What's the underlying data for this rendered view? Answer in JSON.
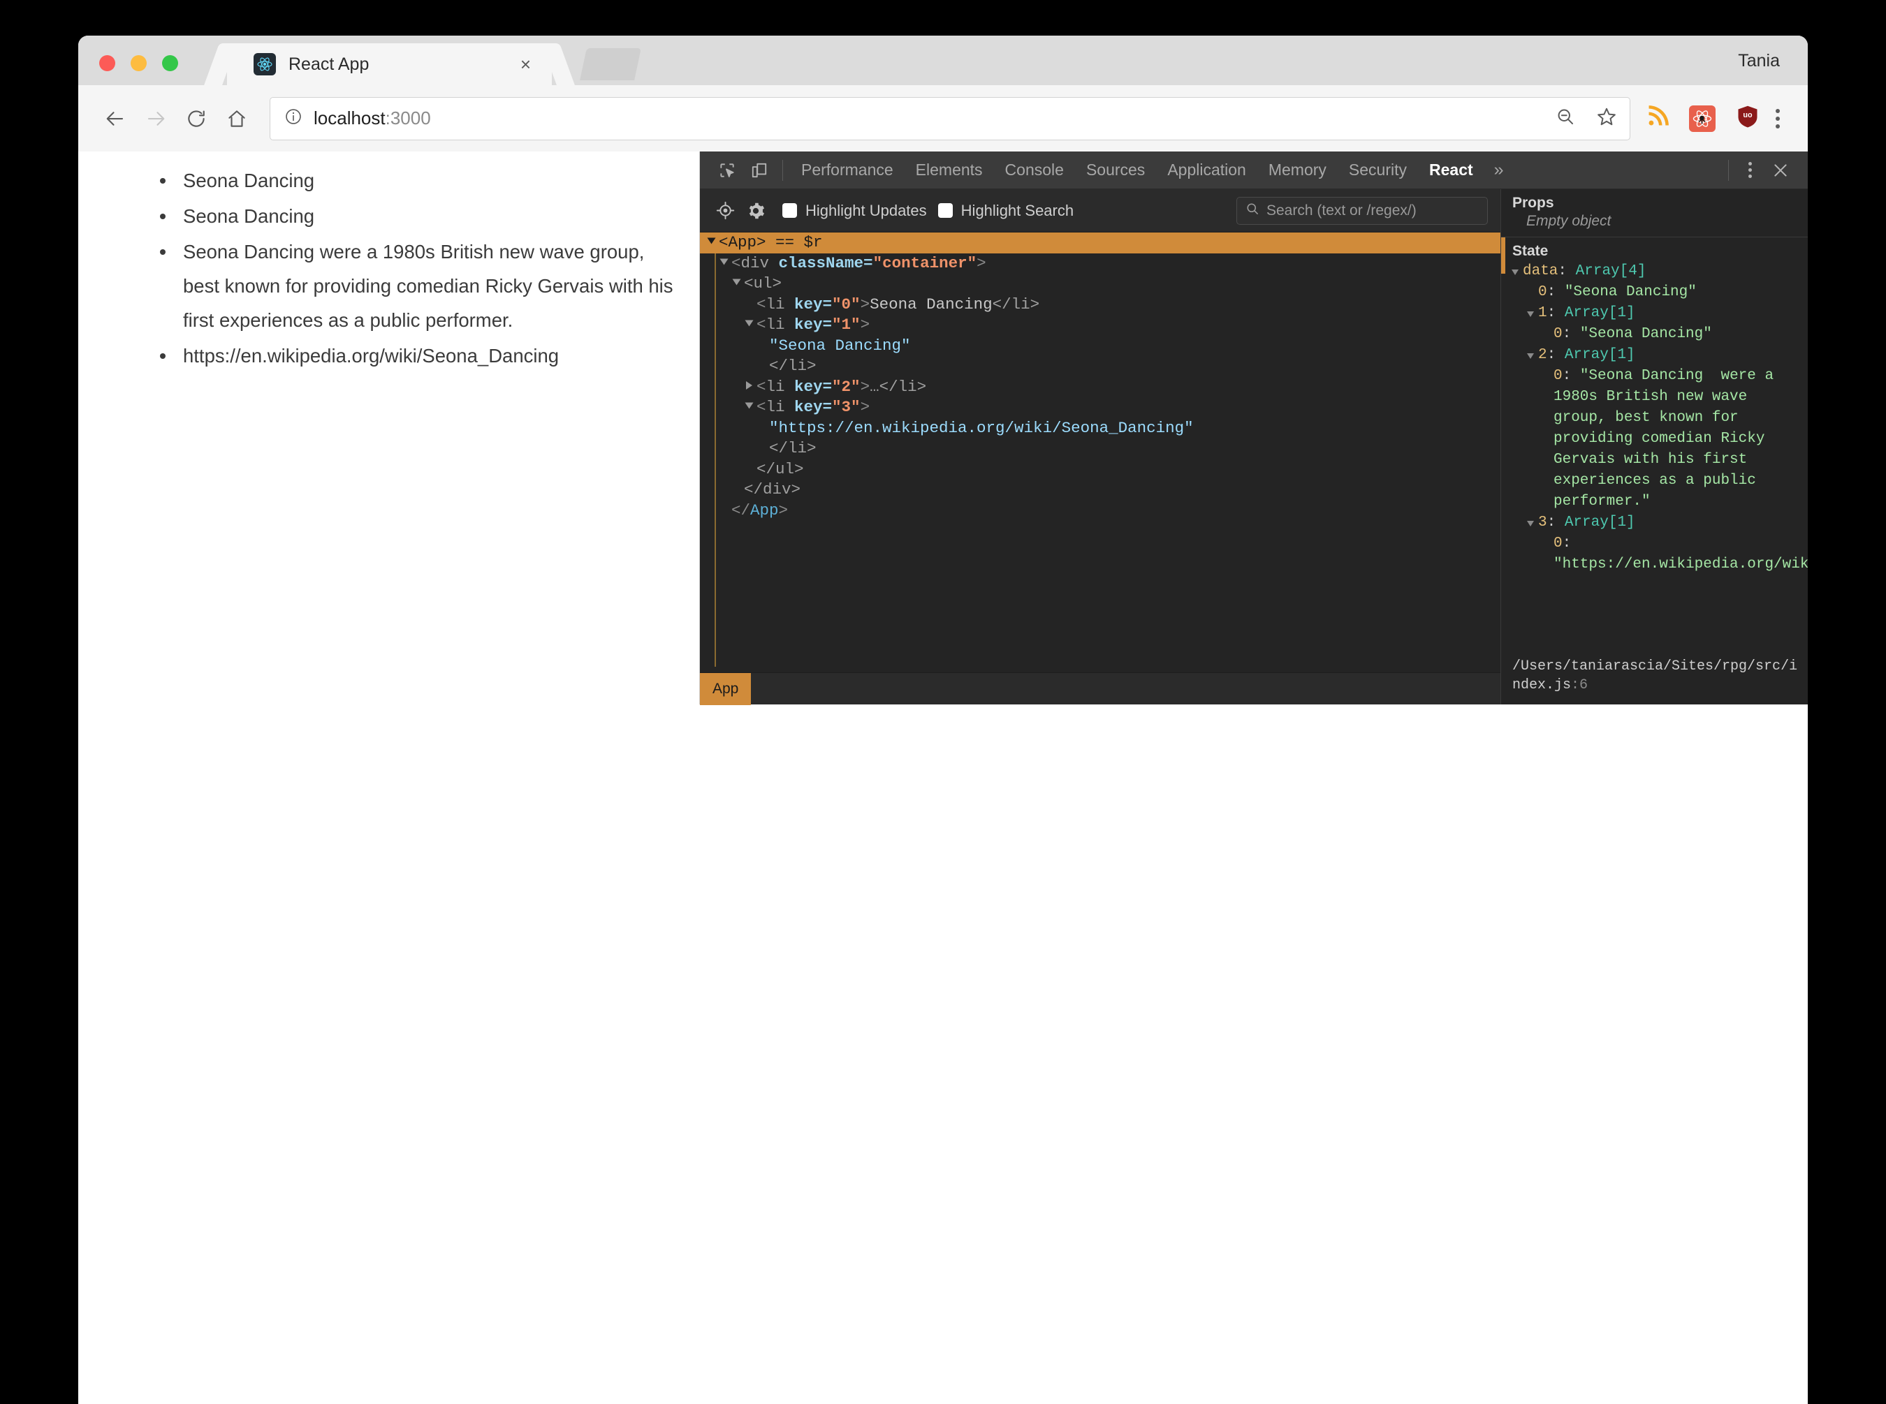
{
  "browser": {
    "tab": {
      "title": "React App",
      "favicon": "react-logo-icon",
      "close": "×"
    },
    "profile_name": "Tania",
    "url": {
      "scheme_icon": "info-circle-icon",
      "host": "localhost",
      "port": ":3000"
    },
    "nav": {
      "back": "back-arrow-icon",
      "forward": "forward-arrow-icon",
      "reload": "reload-icon",
      "home": "home-icon",
      "zoom_out": "zoom-out-icon",
      "bookmark": "star-icon",
      "menu": "kebab-menu-icon"
    },
    "extensions": [
      {
        "name": "rss-feed-icon",
        "color": "#f5a623"
      },
      {
        "name": "react-devtools-extension-icon",
        "color": "#e8604c"
      },
      {
        "name": "ublock-origin-icon",
        "color": "#8b1a1a",
        "label": "uo"
      }
    ]
  },
  "page": {
    "items": [
      "Seona Dancing",
      "Seona Dancing",
      "Seona Dancing were a 1980s British new wave group, best known for providing comedian Ricky Gervais with his first experiences as a public performer.",
      "https://en.wikipedia.org/wiki/Seona_Dancing"
    ]
  },
  "devtools": {
    "inspect_icon": "inspect-element-icon",
    "device_icon": "device-toolbar-icon",
    "tabs": [
      {
        "label": "Performance",
        "active": false
      },
      {
        "label": "Elements",
        "active": false
      },
      {
        "label": "Console",
        "active": false
      },
      {
        "label": "Sources",
        "active": false
      },
      {
        "label": "Application",
        "active": false
      },
      {
        "label": "Memory",
        "active": false
      },
      {
        "label": "Security",
        "active": false
      },
      {
        "label": "React",
        "active": true
      }
    ],
    "more_tabs": "»",
    "close": "✕",
    "react_toolbar": {
      "select_icon": "target-select-icon",
      "settings_icon": "gear-icon",
      "highlight_updates": {
        "label": "Highlight Updates",
        "checked": false
      },
      "highlight_search": {
        "label": "Highlight Search",
        "checked": false
      },
      "search_placeholder": "Search (text or /regex/)",
      "search_value": ""
    },
    "tree": [
      {
        "indent": 0,
        "caret": "open",
        "selected": true,
        "tokens": [
          {
            "t": "tag",
            "v": "<App>"
          },
          {
            "t": "plain",
            "v": " == $r"
          }
        ]
      },
      {
        "indent": 1,
        "caret": "open",
        "selected": false,
        "tokens": [
          {
            "t": "bracket",
            "v": "<"
          },
          {
            "t": "elem",
            "v": "div "
          },
          {
            "t": "attr",
            "v": "className="
          },
          {
            "t": "val",
            "v": "\"container\""
          },
          {
            "t": "bracket",
            "v": ">"
          }
        ]
      },
      {
        "indent": 2,
        "caret": "open",
        "selected": false,
        "tokens": [
          {
            "t": "elem",
            "v": "<ul>"
          }
        ]
      },
      {
        "indent": 3,
        "caret": "none",
        "selected": false,
        "tokens": [
          {
            "t": "bracket",
            "v": "<"
          },
          {
            "t": "elem",
            "v": "li "
          },
          {
            "t": "attr",
            "v": "key="
          },
          {
            "t": "val",
            "v": "\"0\""
          },
          {
            "t": "bracket",
            "v": ">"
          },
          {
            "t": "plain",
            "v": "Seona Dancing"
          },
          {
            "t": "elem",
            "v": "</li>"
          }
        ]
      },
      {
        "indent": 3,
        "caret": "open",
        "selected": false,
        "tokens": [
          {
            "t": "bracket",
            "v": "<"
          },
          {
            "t": "elem",
            "v": "li "
          },
          {
            "t": "attr",
            "v": "key="
          },
          {
            "t": "val",
            "v": "\"1\""
          },
          {
            "t": "bracket",
            "v": ">"
          }
        ]
      },
      {
        "indent": 4,
        "caret": "none",
        "selected": false,
        "tokens": [
          {
            "t": "str",
            "v": "\"Seona Dancing\""
          }
        ]
      },
      {
        "indent": 4,
        "caret": "none",
        "selected": false,
        "tokens": [
          {
            "t": "elem",
            "v": "</li>"
          }
        ]
      },
      {
        "indent": 3,
        "caret": "closed",
        "selected": false,
        "tokens": [
          {
            "t": "bracket",
            "v": "<"
          },
          {
            "t": "elem",
            "v": "li "
          },
          {
            "t": "attr",
            "v": "key="
          },
          {
            "t": "val",
            "v": "\"2\""
          },
          {
            "t": "bracket",
            "v": ">"
          },
          {
            "t": "elem",
            "v": "…</li>"
          }
        ]
      },
      {
        "indent": 3,
        "caret": "open",
        "selected": false,
        "tokens": [
          {
            "t": "bracket",
            "v": "<"
          },
          {
            "t": "elem",
            "v": "li "
          },
          {
            "t": "attr",
            "v": "key="
          },
          {
            "t": "val",
            "v": "\"3\""
          },
          {
            "t": "bracket",
            "v": ">"
          }
        ]
      },
      {
        "indent": 4,
        "caret": "none",
        "selected": false,
        "tokens": [
          {
            "t": "str",
            "v": "\"https://en.wikipedia.org/wiki/Seona_Dancing\""
          }
        ]
      },
      {
        "indent": 4,
        "caret": "none",
        "selected": false,
        "tokens": [
          {
            "t": "elem",
            "v": "</li>"
          }
        ]
      },
      {
        "indent": 3,
        "caret": "none",
        "selected": false,
        "tokens": [
          {
            "t": "elem",
            "v": "</ul>"
          }
        ]
      },
      {
        "indent": 2,
        "caret": "none",
        "selected": false,
        "tokens": [
          {
            "t": "elem",
            "v": "</div>"
          }
        ]
      },
      {
        "indent": 1,
        "caret": "none",
        "selected": false,
        "tokens": [
          {
            "t": "bracket",
            "v": "</"
          },
          {
            "t": "tag",
            "v": "App"
          },
          {
            "t": "bracket",
            "v": ">"
          }
        ]
      }
    ],
    "breadcrumb": "App",
    "sidebar": {
      "props_title": "Props",
      "props_empty": "Empty object",
      "state_title": "State",
      "state_rows": [
        {
          "indent": 0,
          "caret": "open",
          "key": "data",
          "sep": ": ",
          "type": "Array[4]"
        },
        {
          "indent": 1,
          "caret": "none",
          "key": "0",
          "sep": ": ",
          "str": "\"Seona Dancing\""
        },
        {
          "indent": 1,
          "caret": "open",
          "key": "1",
          "sep": ": ",
          "type": "Array[1]"
        },
        {
          "indent": 2,
          "caret": "none",
          "key": "0",
          "sep": ": ",
          "str": "\"Seona Dancing\""
        },
        {
          "indent": 1,
          "caret": "open",
          "key": "2",
          "sep": ": ",
          "type": "Array[1]"
        },
        {
          "indent": 2,
          "caret": "none",
          "key": "0",
          "sep": ": ",
          "str": "\"Seona Dancing  were a 1980s British new wave group, best known for providing comedian Ricky Gervais with his first experiences as a public performer.\""
        },
        {
          "indent": 1,
          "caret": "open",
          "key": "3",
          "sep": ": ",
          "type": "Array[1]"
        },
        {
          "indent": 2,
          "caret": "none",
          "key": "0",
          "sep": ": ",
          "str": "\"https://en.wikipedia.org/wiki/Seona_Dancing\""
        }
      ],
      "source_path": "/Users/taniarascia/Sites/rpg/src/index.js",
      "source_line": ":6"
    }
  },
  "colors": {
    "accent_orange": "#d08b3a",
    "devtools_bg": "#242424",
    "devtools_tabbar": "#3b3b3b",
    "string_green": "#a5e6a5",
    "type_teal": "#4ec9b0",
    "key_yellow": "#e5c07b"
  }
}
